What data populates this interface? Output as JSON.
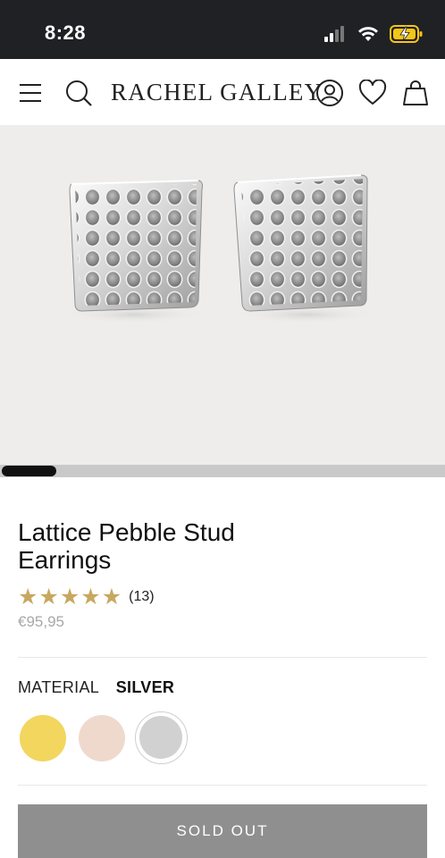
{
  "status_bar": {
    "time": "8:28",
    "icons": [
      "signal-icon",
      "wifi-icon",
      "battery-charging-icon"
    ]
  },
  "header": {
    "brand": "RACHEL GALLEY",
    "icons": [
      "menu-icon",
      "search-icon",
      "account-icon",
      "wishlist-icon",
      "bag-icon"
    ]
  },
  "gallery": {
    "image_subject": "silver lattice pebble stud earrings",
    "slide_position": 0.12
  },
  "product": {
    "title": "Lattice Pebble Stud Earrings",
    "rating": 5,
    "rating_max": 5,
    "review_count": "(13)",
    "price": "€95,95"
  },
  "options": {
    "material_label": "MATERIAL",
    "material_value": "SILVER",
    "swatches": [
      {
        "name": "gold",
        "color": "#f2d65e"
      },
      {
        "name": "rose",
        "color": "#efd9cd"
      },
      {
        "name": "silver",
        "color": "#d1d1d1",
        "selected": true
      }
    ]
  },
  "cta": {
    "label": "SOLD OUT",
    "color": "#8f8f8f"
  },
  "colors": {
    "star": "#c8a860",
    "status_bar_bg": "#202124",
    "battery_fill": "#f5c518"
  }
}
